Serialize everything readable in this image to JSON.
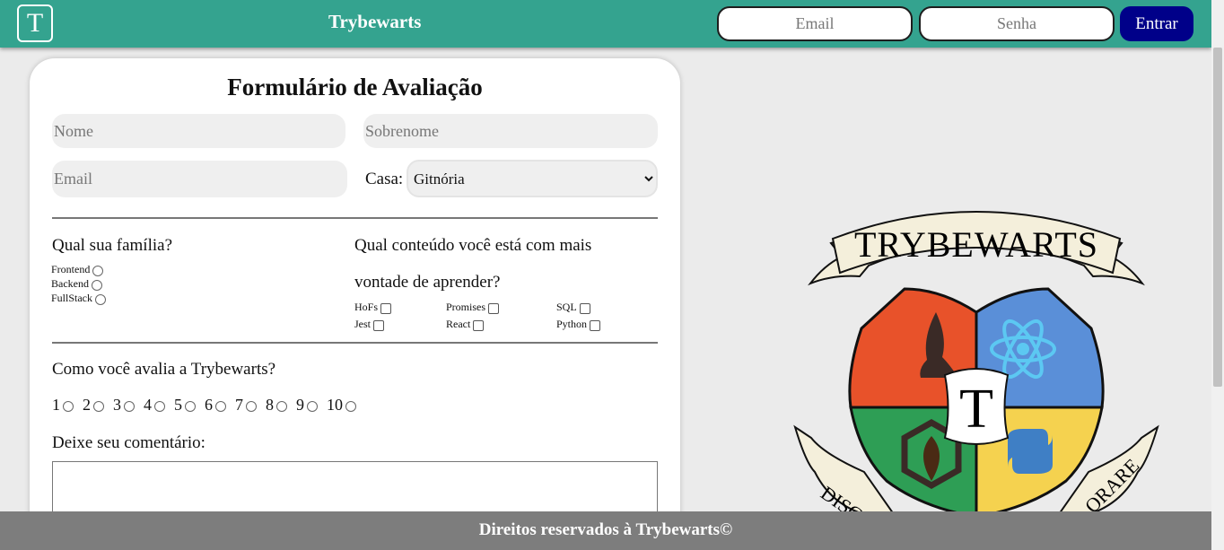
{
  "header": {
    "logo_letter": "T",
    "title": "Trybewarts",
    "email_placeholder": "Email",
    "password_placeholder": "Senha",
    "login_button": "Entrar"
  },
  "form": {
    "title": "Formulário de Avaliação",
    "name_placeholder": "Nome",
    "lastname_placeholder": "Sobrenome",
    "email_placeholder": "Email",
    "house_label": "Casa:",
    "house_selected": "Gitnória",
    "family_question": "Qual sua família?",
    "family_options": [
      "Frontend",
      "Backend",
      "FullStack"
    ],
    "content_question_line1": "Qual conteúdo você está com mais",
    "content_question_line2": "vontade de aprender?",
    "content_options": [
      "HoFs",
      "Promises",
      "SQL",
      "Jest",
      "React",
      "Python"
    ],
    "rating_question": "Como você avalia a Trybewarts?",
    "rating_values": [
      "1",
      "2",
      "3",
      "4",
      "5",
      "6",
      "7",
      "8",
      "9",
      "10"
    ],
    "comment_label": "Deixe seu comentário:"
  },
  "crest": {
    "banner_text": "TRYBEWARTS",
    "center_letter": "T",
    "motto_left": "DISC",
    "motto_right": "ORARE"
  },
  "footer": {
    "text": "Direitos reservados à Trybewarts©"
  },
  "colors": {
    "header": "#34a38f",
    "login_button": "#000089",
    "footer": "#7d7d7d",
    "crest_red": "#e8522a",
    "crest_blue": "#5a8fd8",
    "crest_green": "#2e9e55",
    "crest_yellow": "#f5d24f"
  }
}
